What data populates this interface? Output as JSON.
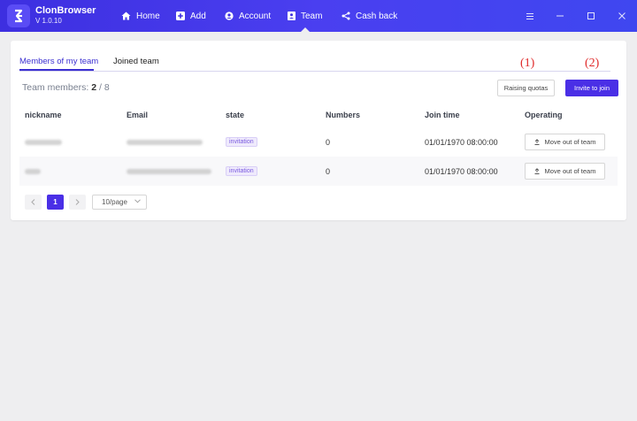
{
  "app": {
    "name": "ClonBrowser",
    "version": "V 1.0.10"
  },
  "nav": [
    {
      "label": "Home",
      "icon": "home-icon"
    },
    {
      "label": "Add",
      "icon": "plus-square-icon"
    },
    {
      "label": "Account",
      "icon": "user-circle-icon"
    },
    {
      "label": "Team",
      "icon": "team-icon",
      "active": true
    },
    {
      "label": "Cash back",
      "icon": "share-icon"
    }
  ],
  "window_controls": [
    "menu-icon",
    "minimize-icon",
    "maximize-icon",
    "close-icon"
  ],
  "tabs": [
    {
      "label": "Members of my team",
      "active": true
    },
    {
      "label": "Joined team",
      "active": false
    }
  ],
  "annotations": {
    "a1": "(1)",
    "a2": "(2)"
  },
  "summary": {
    "label": "Team members:",
    "current": "2",
    "separator": "/",
    "max": "8"
  },
  "actions": {
    "raise_quota": "Raising quotas",
    "invite": "Invite to join"
  },
  "table": {
    "headers": [
      "nickname",
      "Email",
      "state",
      "Numbers",
      "Join time",
      "Operating"
    ],
    "rows": [
      {
        "state": "invitation",
        "numbers": "0",
        "join_time": "01/01/1970 08:00:00",
        "action": "Move out of team"
      },
      {
        "state": "invitation",
        "numbers": "0",
        "join_time": "01/01/1970 08:00:00",
        "action": "Move out of team"
      }
    ]
  },
  "pagination": {
    "current_page": "1",
    "page_size": "10/page"
  },
  "colors": {
    "accent": "#4a2fe6",
    "topbar": "#3d2fe0",
    "annotation": "#e02a2a"
  }
}
